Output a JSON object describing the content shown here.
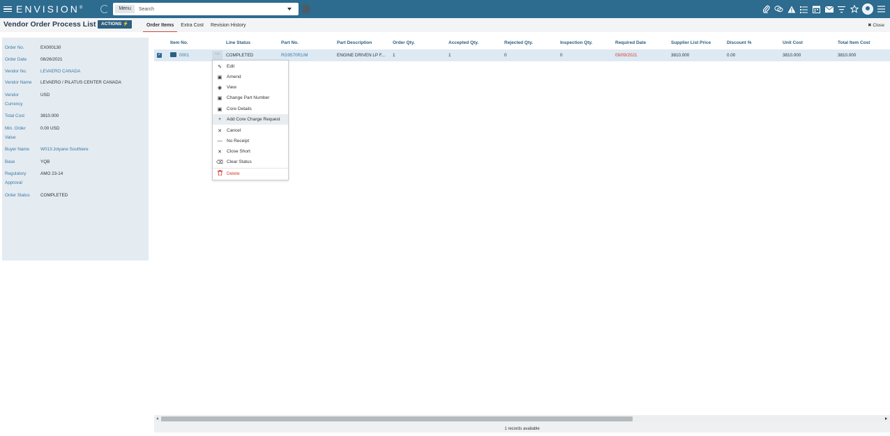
{
  "topbar": {
    "logo": "ENVISION",
    "logo_mark": "®",
    "menu_label": "Menu",
    "search_placeholder": "Search",
    "icons": [
      "paperclip-icon",
      "chat-icon",
      "warning-icon",
      "list-icon",
      "calendar-icon",
      "mail-icon",
      "filter-icon",
      "star-icon",
      "avatar",
      "menu-icon"
    ]
  },
  "header": {
    "title": "Vendor Order Process List",
    "actions_label": "ACTIONS ⚡",
    "tabs": [
      "Order Items",
      "Extra Cost",
      "Revision History"
    ],
    "close_label": "✖ Close"
  },
  "details": [
    {
      "label": "Order No.",
      "value": "EX000130",
      "link": false
    },
    {
      "label": "Order Date",
      "value": "08/26/2021",
      "link": false
    },
    {
      "label": "Vendor No.",
      "value": "LEVAERO CANADA",
      "link": true
    },
    {
      "label": "Vendor Name",
      "value": "LEVAERO / PILATUS CENTER CANADA",
      "link": false
    },
    {
      "label": "Vendor Currency",
      "value": "USD",
      "link": false
    },
    {
      "label": "Total Cost",
      "value": "3810.000",
      "link": false
    },
    {
      "label": "Min. Order Value",
      "value": "0.00 USD",
      "link": false
    },
    {
      "label": "Buyer Name",
      "value": "W013:Jolyane Southiere",
      "link": true
    },
    {
      "label": "Base",
      "value": "YQB",
      "link": false
    },
    {
      "label": "Regulatory Approval",
      "value": "AMO 23-14",
      "link": false
    },
    {
      "label": "Order Status",
      "value": "COMPLETED",
      "link": false
    }
  ],
  "grid": {
    "columns": [
      "Item No.",
      "Line Status",
      "Part No.",
      "Part Description",
      "Order Qty.",
      "Accepted Qty.",
      "Rejected Qty.",
      "Inspection Qty.",
      "Required Date",
      "Supplier List Price",
      "Discount %",
      "Unit Cost",
      "Total Item Cost"
    ],
    "rows": [
      {
        "item_no": "0001",
        "line_status": "COMPLETED",
        "part_no": "RG9570R1/M",
        "part_description": "ENGINE DRIVEN LP F...",
        "order_qty": "1",
        "accepted_qty": "1",
        "rejected_qty": "0",
        "inspection_qty": "0",
        "required_date": "09/09/2021",
        "supplier_list_price": "3810.000",
        "discount": "0.00",
        "unit_cost": "3810.000",
        "total_item_cost": "3810.000"
      }
    ]
  },
  "context_menu": [
    {
      "label": "Edit",
      "icon": "pencil-icon",
      "glyph": "✎"
    },
    {
      "label": "Amend",
      "icon": "document-icon",
      "glyph": "▣"
    },
    {
      "label": "View",
      "icon": "eye-icon",
      "glyph": "◉"
    },
    {
      "label": "Change Part Number",
      "icon": "document-icon",
      "glyph": "▣"
    },
    {
      "label": "Core Details",
      "icon": "document-icon",
      "glyph": "▣"
    },
    {
      "label": "Add Core Charge Request",
      "icon": "plus-icon",
      "glyph": "+"
    },
    {
      "label": "Cancel",
      "icon": "close-icon",
      "glyph": "✕"
    },
    {
      "label": "No Receipt",
      "icon": "minus-icon",
      "glyph": "—"
    },
    {
      "label": "Close Short",
      "icon": "close-icon",
      "glyph": "✕"
    },
    {
      "label": "Clear Status",
      "icon": "eraser-icon",
      "glyph": "⌫"
    },
    {
      "label": "Delete",
      "icon": "trash-icon",
      "glyph": "🗑"
    }
  ],
  "footer": {
    "records": "1 records available"
  },
  "colors": {
    "topbar": "#2d6b8f",
    "link": "#3a7aa3",
    "danger": "#d63b2f",
    "panel": "#e4ebf1",
    "selected_row": "#dde9f3"
  }
}
